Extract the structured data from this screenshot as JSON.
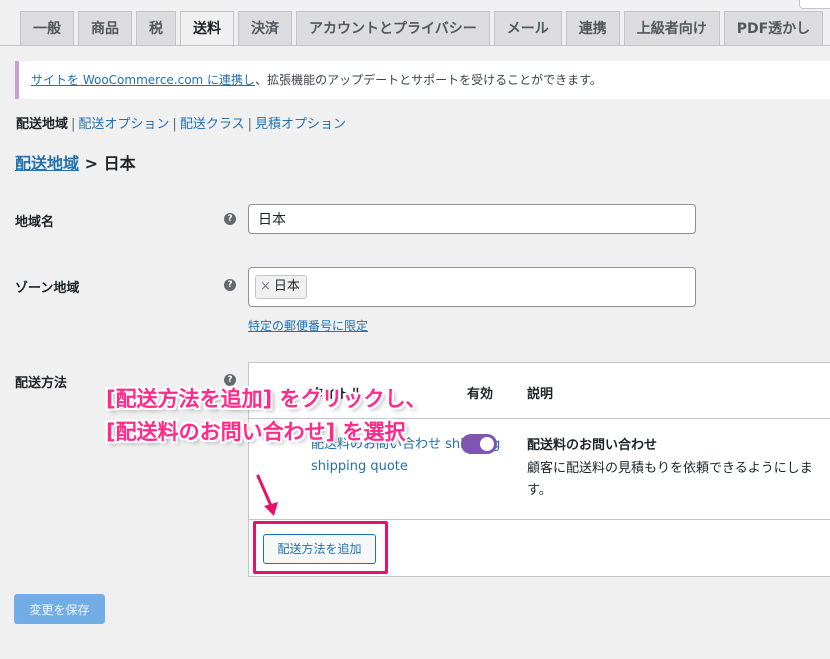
{
  "tabs": [
    {
      "label": "一般"
    },
    {
      "label": "商品"
    },
    {
      "label": "税"
    },
    {
      "label": "送料",
      "active": true
    },
    {
      "label": "決済"
    },
    {
      "label": "アカウントとプライバシー"
    },
    {
      "label": "メール"
    },
    {
      "label": "連携"
    },
    {
      "label": "上級者向け"
    },
    {
      "label": "PDF透かし"
    }
  ],
  "notice": {
    "link_text": "サイトを WooCommerce.com に連携し",
    "rest_text": "、拡張機能のアップデートとサポートを受けることができます。"
  },
  "subnav": {
    "current": "配送地域",
    "items": [
      "配送オプション",
      "配送クラス",
      "見積オプション"
    ]
  },
  "breadcrumb": {
    "link": "配送地域",
    "separator": " > ",
    "current": "日本"
  },
  "form": {
    "zone_name_label": "地域名",
    "zone_name_value": "日本",
    "zone_regions_label": "ゾーン地域",
    "region_chip": "日本",
    "region_chip_remove": "×",
    "postcode_link": "特定の郵便番号に限定",
    "methods_label": "配送方法",
    "help_glyph": "?"
  },
  "methods_table": {
    "headers": {
      "title": "タイトル",
      "enabled": "有効",
      "description": "説明"
    },
    "rows": [
      {
        "title": "配送料のお問い合わせ shipping",
        "title_sub": "shipping quote",
        "enabled": true,
        "desc_title": "配送料のお問い合わせ",
        "desc_text": "顧客に配送料の見積もりを依頼できるようにします。"
      }
    ],
    "add_button": "配送方法を追加"
  },
  "save_button": "変更を保存",
  "annotation": {
    "line1": "[配送方法を追加] をクリックし、",
    "line2": "[配送料のお問い合わせ] を選択"
  },
  "colors": {
    "accent": "#2271b1",
    "annotation": "#ff2a8a",
    "toggle_on": "#7f54b3"
  }
}
